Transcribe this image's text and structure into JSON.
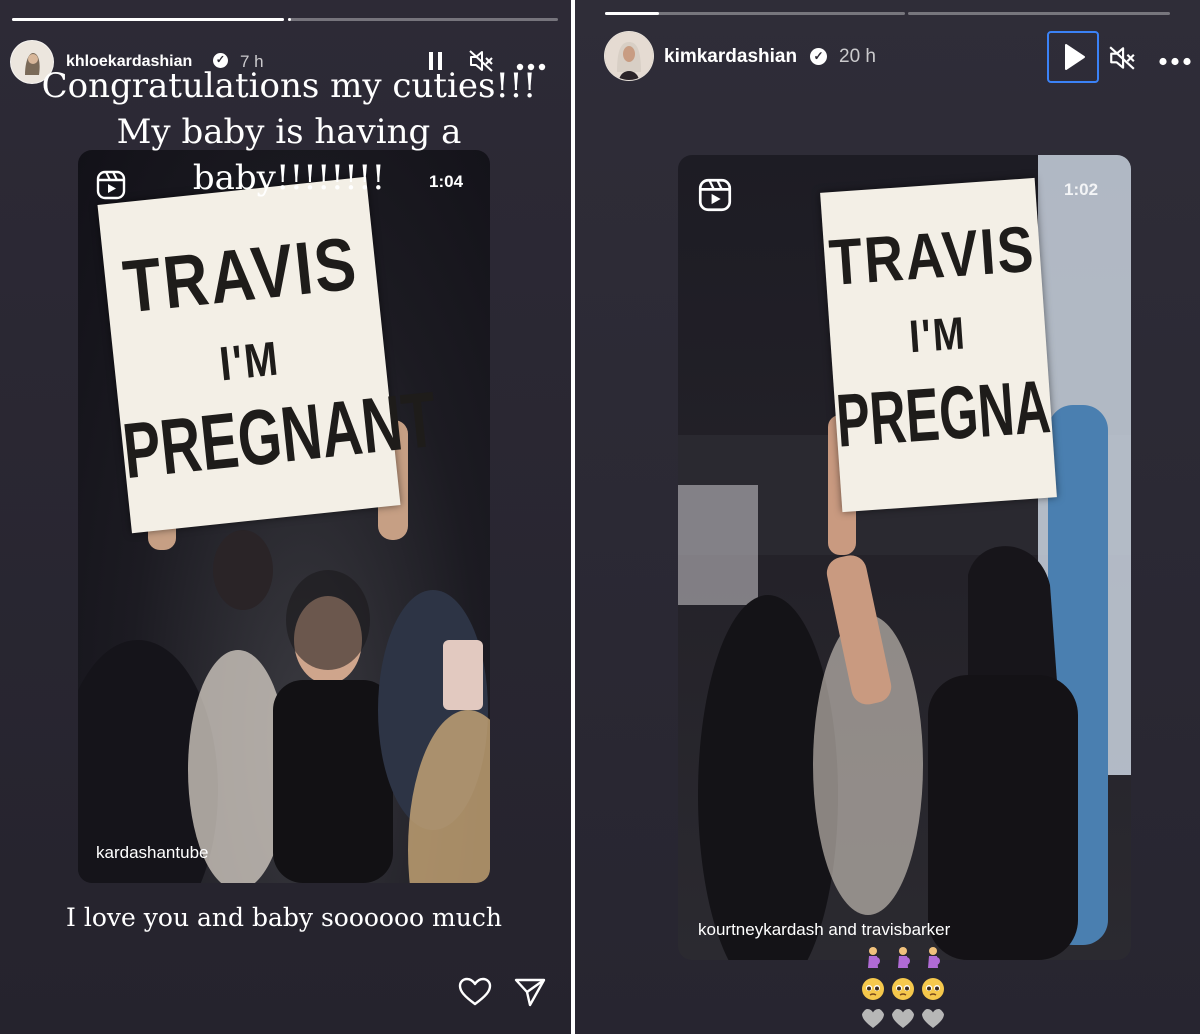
{
  "left_story": {
    "username": "khloekardashian",
    "time_ago": "7 h",
    "caption_top": "Congratulations my cuties!!! My baby is having a baby!!!!!!!!",
    "caption_lines": [
      "Congratulations my cuties!!!",
      "My baby is having a",
      "baby!!!!!!!!"
    ],
    "caption_bottom": "I love you and baby soooooo much",
    "reel": {
      "duration": "1:04",
      "credit": "kardashantube",
      "sign_lines": [
        "TRAVIS",
        "I'M",
        "PREGNANT"
      ]
    },
    "controls": [
      "pause-icon",
      "muted-icon",
      "more-icon"
    ],
    "actions": [
      "heart-icon",
      "send-icon"
    ]
  },
  "right_story": {
    "username": "kimkardashian",
    "time_ago": "20 h",
    "reel": {
      "duration": "1:02",
      "credit": "kourtneykardash and travisbarker",
      "sign_lines": [
        "TRAVIS",
        "I'M",
        "PREGNA"
      ]
    },
    "controls": [
      "play-icon",
      "muted-icon",
      "more-icon"
    ],
    "emoji_rows": [
      [
        "pregnant-woman-emoji",
        "pregnant-woman-emoji",
        "pregnant-woman-emoji"
      ],
      [
        "pleading-face-emoji",
        "pleading-face-emoji",
        "pleading-face-emoji"
      ],
      [
        "grey-heart-emoji",
        "grey-heart-emoji",
        "grey-heart-emoji"
      ]
    ]
  },
  "colors": {
    "background": "#292732",
    "text": "#ffffff",
    "divider": "#ffffff",
    "focus_ring": "#3b82f6"
  }
}
